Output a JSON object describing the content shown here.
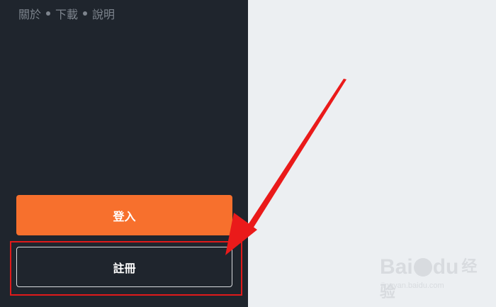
{
  "nav": {
    "about_label": "關於",
    "download_label": "下載",
    "help_label": "說明"
  },
  "buttons": {
    "login_label": "登入",
    "register_label": "註冊"
  },
  "watermark": {
    "brand_latin": "Bai",
    "brand_latin2": "du",
    "brand_cn": "经验",
    "url": "jingyan.baidu.com"
  },
  "colors": {
    "sidebar_bg": "#1f252d",
    "login_bg": "#f7702d",
    "annotation": "#e01a1a",
    "page_bg": "#eceff2"
  },
  "icons": [
    "paw-icon"
  ]
}
